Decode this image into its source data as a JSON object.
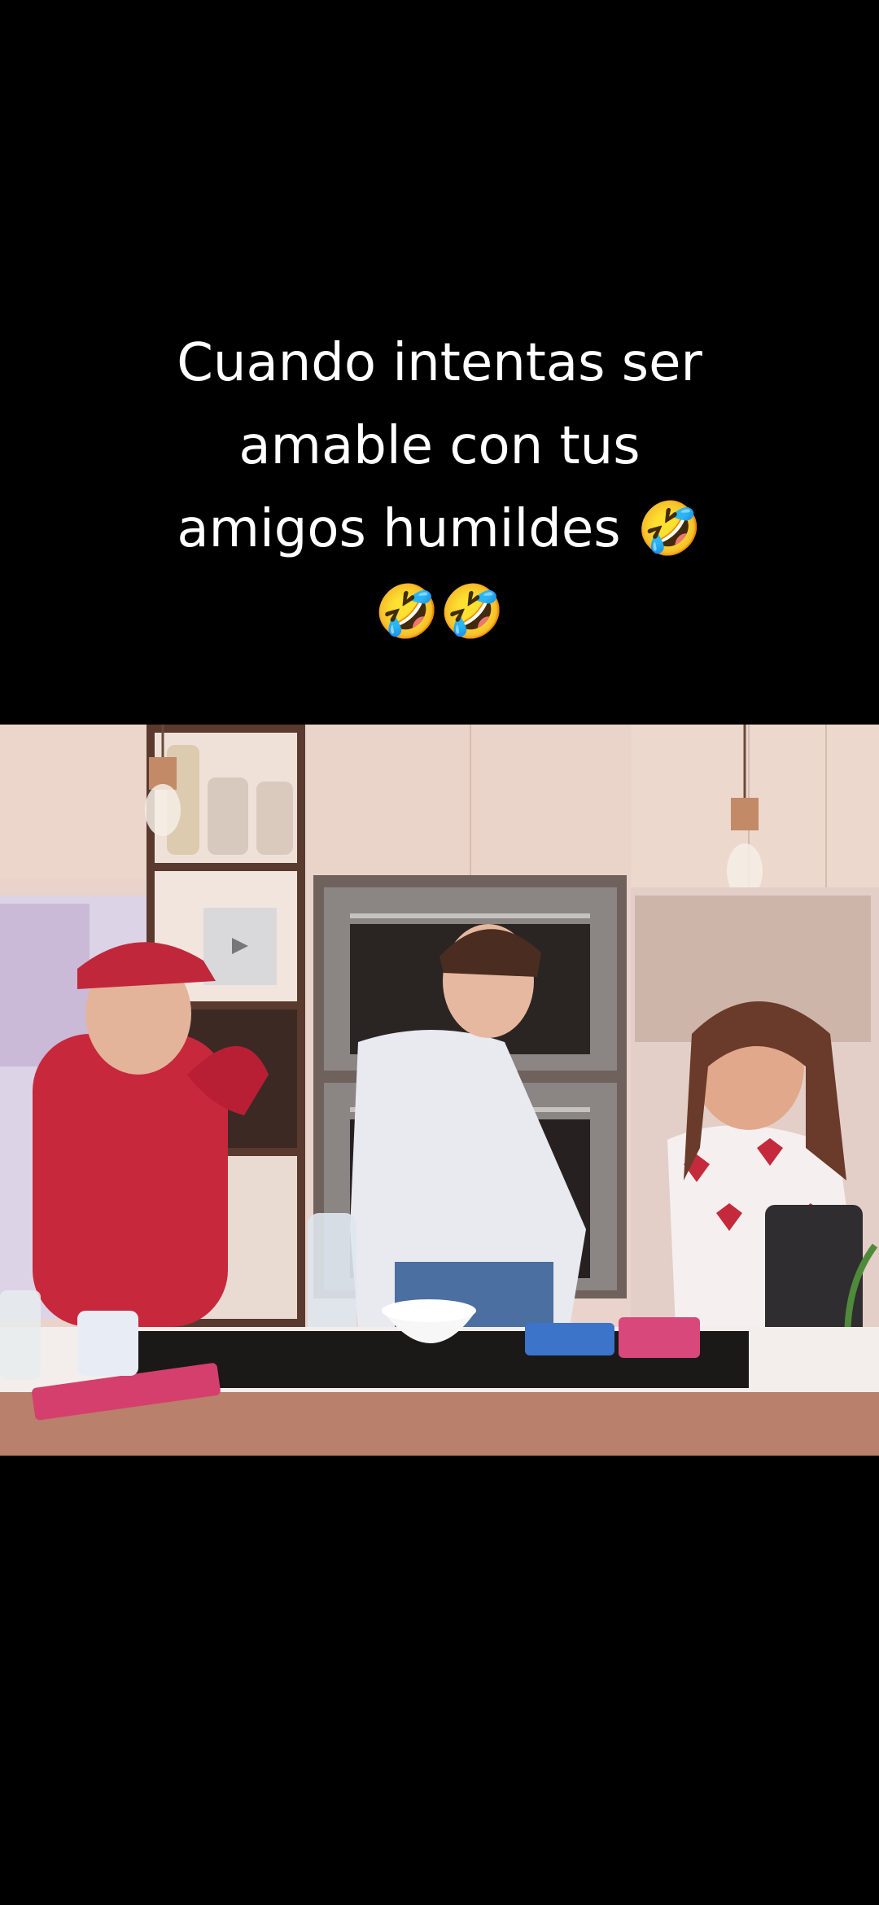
{
  "caption": {
    "line1": "Cuando intentas ser",
    "line2": "amable con tus",
    "line3": "amigos humildes 🤣",
    "line4": "🤣🤣"
  },
  "video": {
    "scene": "kitchen-video-frame"
  },
  "colors": {
    "background": "#000000",
    "caption_text": "#ffffff",
    "wall": "#e7cfc6",
    "hoodie": "#c8283c",
    "counter": "#b9806b"
  }
}
